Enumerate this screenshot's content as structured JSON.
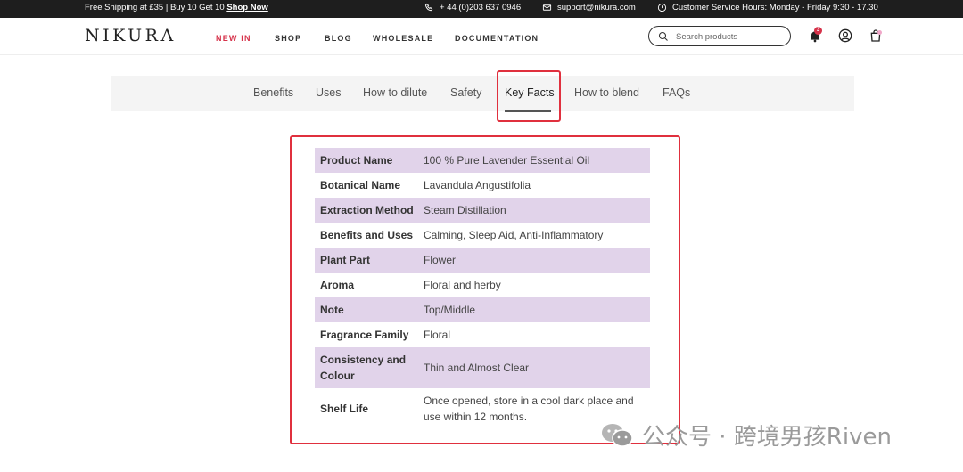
{
  "topbar": {
    "promo_text": "Free Shipping at £35 | Buy 10 Get 10",
    "promo_link": "Shop Now",
    "phone": "+ 44 (0)203 637 0946",
    "email": "support@nikura.com",
    "hours": "Customer Service Hours: Monday - Friday 9:30 - 17.30"
  },
  "header": {
    "logo": "NIKURA",
    "nav": [
      "NEW IN",
      "SHOP",
      "BLOG",
      "WHOLESALE",
      "DOCUMENTATION"
    ],
    "search_placeholder": "Search products",
    "notification_count": "3"
  },
  "tabs": {
    "items": [
      "Benefits",
      "Uses",
      "How to dilute",
      "Safety",
      "Key Facts",
      "How to blend",
      "FAQs"
    ],
    "active": "Key Facts"
  },
  "facts": [
    {
      "key": "Product Name",
      "value": "100 % Pure Lavender Essential Oil"
    },
    {
      "key": "Botanical Name",
      "value": "Lavandula Angustifolia"
    },
    {
      "key": "Extraction Method",
      "value": "Steam Distillation"
    },
    {
      "key": "Benefits and Uses",
      "value": "Calming, Sleep Aid, Anti-Inflammatory"
    },
    {
      "key": "Plant Part",
      "value": "Flower"
    },
    {
      "key": "Aroma",
      "value": "Floral and herby"
    },
    {
      "key": "Note",
      "value": "Top/Middle"
    },
    {
      "key": "Fragrance Family",
      "value": "Floral"
    },
    {
      "key": "Consistency and Colour",
      "value": "Thin and Almost Clear"
    },
    {
      "key": "Shelf Life",
      "value": "Once opened, store in a cool dark place and use within 12 months."
    }
  ],
  "watermark": "公众号 · 跨境男孩Riven",
  "colors": {
    "accent": "#d6324a",
    "highlight": "#e0303e",
    "row_shade": "#e1d3ea",
    "topbar_bg": "#1e1e1e"
  }
}
